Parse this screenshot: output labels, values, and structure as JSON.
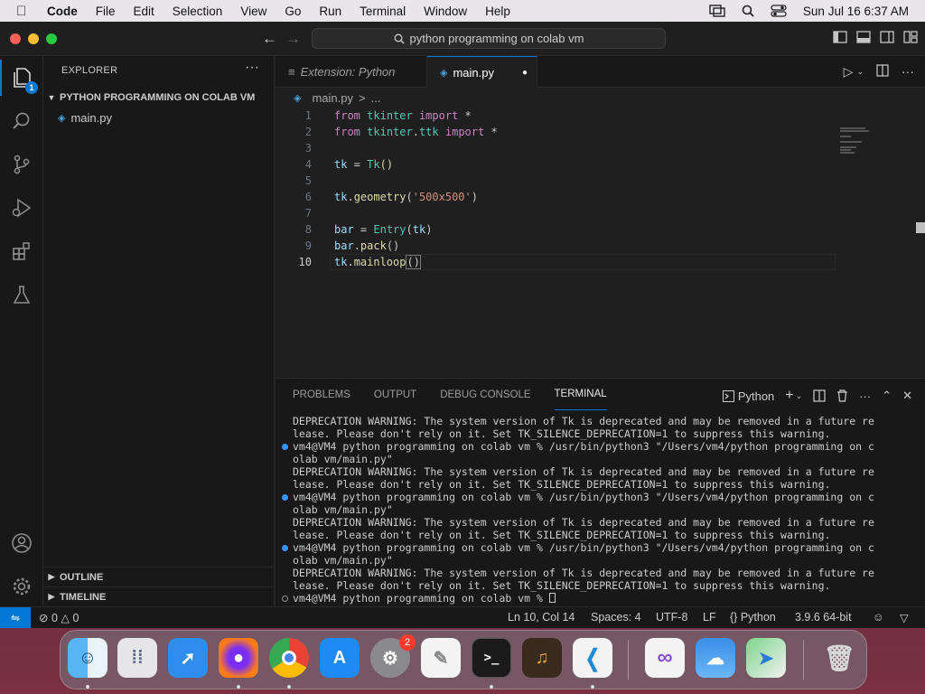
{
  "menubar": {
    "app_name": "Code",
    "items": [
      "File",
      "Edit",
      "Selection",
      "View",
      "Go",
      "Run",
      "Terminal",
      "Window",
      "Help"
    ],
    "clock": "Sun Jul 16  6:37 AM"
  },
  "titlebar": {
    "search_text": "python programming on colab vm"
  },
  "activity_bar": {
    "extensions_badge": "1",
    "icons": [
      "explorer-icon",
      "search-icon",
      "source-control-icon",
      "run-debug-icon",
      "extensions-icon",
      "testing-icon",
      "account-icon",
      "settings-gear-icon"
    ]
  },
  "sidebar": {
    "title": "EXPLORER",
    "more": "···",
    "folder_name": "PYTHON PROGRAMMING ON COLAB VM",
    "files": [
      "main.py"
    ],
    "outline_label": "OUTLINE",
    "timeline_label": "TIMELINE"
  },
  "tabs": [
    {
      "label": "Extension: Python",
      "active": false
    },
    {
      "label": "main.py",
      "active": true,
      "dirty_marker": "●"
    }
  ],
  "breadcrumb": {
    "file": "main.py",
    "separator": ">",
    "tail": "..."
  },
  "editor": {
    "line_numbers": [
      "1",
      "2",
      "3",
      "4",
      "5",
      "6",
      "7",
      "8",
      "9",
      "10"
    ],
    "lines": [
      "from tkinter import *",
      "from tkinter.ttk import *",
      "",
      "tk = Tk()",
      "",
      "tk.geometry('500x500')",
      "",
      "bar = Entry(tk)",
      "bar.pack()",
      "tk.mainloop()"
    ],
    "current_line": "10"
  },
  "panel": {
    "tabs": [
      "PROBLEMS",
      "OUTPUT",
      "DEBUG CONSOLE",
      "TERMINAL"
    ],
    "active_tab": "TERMINAL",
    "terminal_name": "Python",
    "terminal_lines": [
      {
        "text": "DEPRECATION WARNING: The system version of Tk is deprecated and may be removed in a future re",
        "dot": "none"
      },
      {
        "text": "lease. Please don't rely on it. Set TK_SILENCE_DEPRECATION=1 to suppress this warning.",
        "dot": "none"
      },
      {
        "text": "vm4@VM4 python programming on colab vm % /usr/bin/python3 \"/Users/vm4/python programming on c",
        "dot": "blue"
      },
      {
        "text": "olab vm/main.py\"",
        "dot": "none"
      },
      {
        "text": "DEPRECATION WARNING: The system version of Tk is deprecated and may be removed in a future re",
        "dot": "none"
      },
      {
        "text": "lease. Please don't rely on it. Set TK_SILENCE_DEPRECATION=1 to suppress this warning.",
        "dot": "none"
      },
      {
        "text": "vm4@VM4 python programming on colab vm % /usr/bin/python3 \"/Users/vm4/python programming on c",
        "dot": "blue"
      },
      {
        "text": "olab vm/main.py\"",
        "dot": "none"
      },
      {
        "text": "DEPRECATION WARNING: The system version of Tk is deprecated and may be removed in a future re",
        "dot": "none"
      },
      {
        "text": "lease. Please don't rely on it. Set TK_SILENCE_DEPRECATION=1 to suppress this warning.",
        "dot": "none"
      },
      {
        "text": "vm4@VM4 python programming on colab vm % /usr/bin/python3 \"/Users/vm4/python programming on c",
        "dot": "blue"
      },
      {
        "text": "olab vm/main.py\"",
        "dot": "none"
      },
      {
        "text": "DEPRECATION WARNING: The system version of Tk is deprecated and may be removed in a future re",
        "dot": "none"
      },
      {
        "text": "lease. Please don't rely on it. Set TK_SILENCE_DEPRECATION=1 to suppress this warning.",
        "dot": "none"
      },
      {
        "text": "vm4@VM4 python programming on colab vm % ",
        "dot": "hollow"
      }
    ]
  },
  "statusbar": {
    "errors": "0",
    "warnings": "0",
    "position": "Ln 10, Col 14",
    "spaces": "Spaces: 4",
    "encoding": "UTF-8",
    "eol": "LF",
    "language": "Python",
    "interpreter": "3.9.6 64-bit"
  },
  "dock": {
    "apps": [
      "Finder",
      "Launchpad",
      "Safari",
      "Firefox",
      "Chrome",
      "App Store",
      "System Settings",
      "TextEdit",
      "Terminal",
      "GarageBand",
      "Visual Studio Code",
      "Visual Studio",
      "Weather",
      "Maps",
      "Trash"
    ],
    "settings_badge": "2"
  },
  "colors": {
    "accent": "#0078d4",
    "editor_bg": "#1f1f1f",
    "sidebar_bg": "#181818",
    "keyword": "#c586c0",
    "module": "#4ec9b0",
    "string": "#ce9178",
    "function": "#dcdcaa"
  }
}
